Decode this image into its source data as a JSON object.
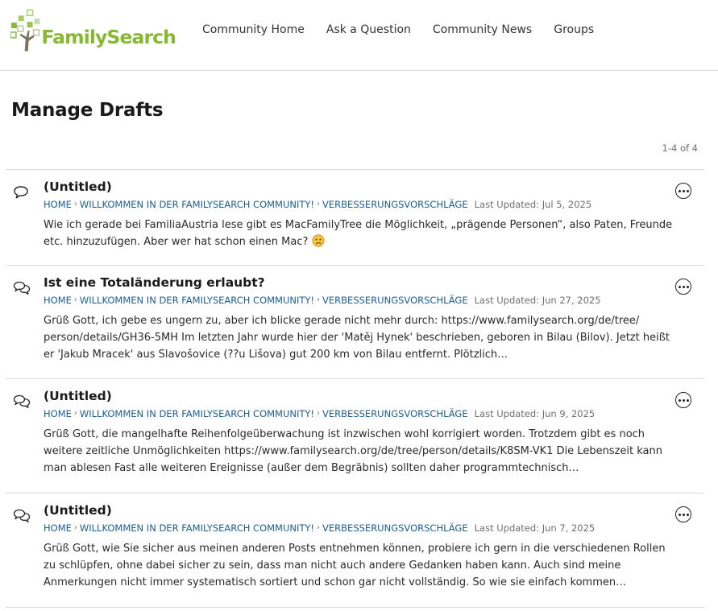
{
  "header": {
    "logo_text": "FamilySearch",
    "nav": [
      "Community Home",
      "Ask a Question",
      "Community News",
      "Groups"
    ]
  },
  "page": {
    "title": "Manage Drafts",
    "count": "1-4 of 4"
  },
  "drafts": [
    {
      "icon": "single-comment-icon",
      "title": "(Untitled)",
      "breadcrumbs": [
        "Home",
        "Willkommen in der FamilySearch Community!",
        "Verbesserungsvorschläge"
      ],
      "updated": "Last Updated: Jul 5, 2025",
      "excerpt": "Wie ich gerade bei FamiliaAustria lese gibt es MacFamilyTree die Möglichkeit, „prägende Personen“, also Paten, Freunde etc. hinzuzufügen. Aber wer hat schon einen Mac?",
      "emoji": "sad-face-emoji"
    },
    {
      "icon": "discussion-icon",
      "title": "Ist eine Totaländerung erlaubt?",
      "breadcrumbs": [
        "Home",
        "Willkommen in der FamilySearch Community!",
        "Verbesserungsvorschläge"
      ],
      "updated": "Last Updated: Jun 27, 2025",
      "excerpt": "Grüß Gott, ich gebe es ungern zu, aber ich blicke gerade nicht mehr durch: https://www.familysearch.org/de/tree/ person/details/GH36-5MH Im letzten Jahr wurde hier der 'Matěj Hynek' beschrieben, geboren in Bilau (Bilov). Jetzt heißt er 'Jakub Mracek' aus Slavošovice (??u Lišova) gut 200 km von Bilau entfernt. Plötzlich…"
    },
    {
      "icon": "discussion-icon",
      "title": "(Untitled)",
      "breadcrumbs": [
        "Home",
        "Willkommen in der FamilySearch Community!",
        "Verbesserungsvorschläge"
      ],
      "updated": "Last Updated: Jun 9, 2025",
      "excerpt": "Grüß Gott, die mangelhafte Reihenfolgeüberwachung ist inzwischen wohl korrigiert worden. Trotzdem gibt es noch weitere zeitliche Unmöglichkeiten https://www.familysearch.org/de/tree/person/details/K8SM-VK1 Die Lebenszeit kann man ablesen Fast alle weiteren Ereignisse (außer dem Begräbnis) sollten daher programmtechnisch…"
    },
    {
      "icon": "discussion-icon",
      "title": "(Untitled)",
      "breadcrumbs": [
        "Home",
        "Willkommen in der FamilySearch Community!",
        "Verbesserungsvorschläge"
      ],
      "updated": "Last Updated: Jun 7, 2025",
      "excerpt": "Grüß Gott, wie Sie sicher aus meinen anderen Posts entnehmen können, probiere ich gern in die verschiedenen Rollen zu schlüpfen, ohne dabei sicher zu sein, dass man nicht auch andere Gedanken haben kann. Auch sind meine Anmerkungen nicht immer systematisch sortiert und schon gar nicht vollständig. So wie sie einfach kommen…"
    }
  ]
}
